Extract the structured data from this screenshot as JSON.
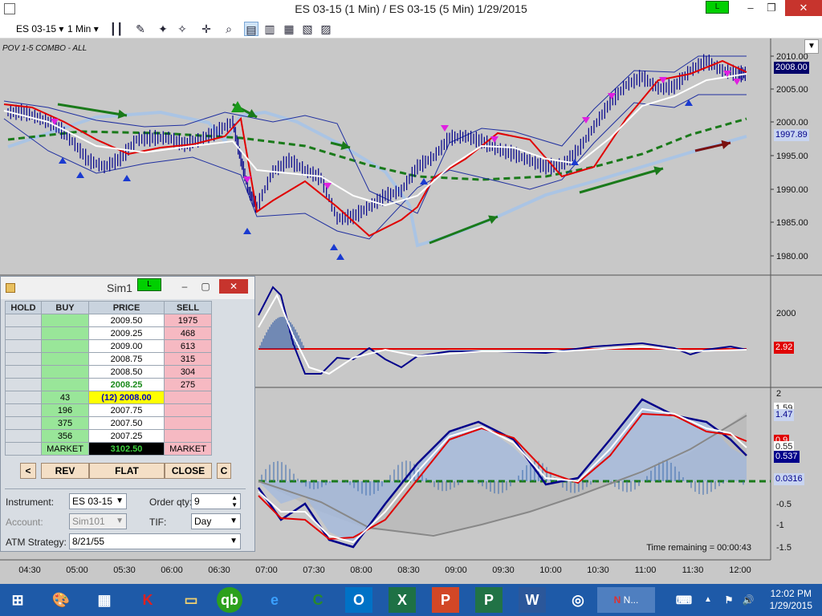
{
  "window": {
    "title": "ES 03-15 (1 Min) / ES 03-15 (5 Min)  1/29/2015",
    "status_badge": "L",
    "minimize": "–",
    "maximize": "❐",
    "close": "✕"
  },
  "toolbar": {
    "instrument": "ES 03-15",
    "interval": "1 Min"
  },
  "chart": {
    "name": "POV 1-5 COMBO - ALL",
    "price_axis": [
      "2010.00",
      "2005.00",
      "2000.00",
      "1995.00",
      "1990.00",
      "1985.00",
      "1980.00"
    ],
    "last_price": "2008.00",
    "other_price": "1997.89",
    "panel2_axis": [
      "2000"
    ],
    "panel2_value": "2.92",
    "panel3_axis": [
      "2",
      "-0.5",
      "-1",
      "-1.5"
    ],
    "panel3_values": [
      "1.59",
      "1.47",
      "0.9",
      "0.55",
      "0.537",
      "0.0316"
    ],
    "time_remaining": "Time remaining = 00:00:43",
    "time_axis": [
      "04:30",
      "05:00",
      "05:30",
      "06:00",
      "06:30",
      "07:00",
      "07:30",
      "08:00",
      "08:30",
      "09:00",
      "09:30",
      "10:00",
      "10:30",
      "11:00",
      "11:30",
      "12:00"
    ],
    "colors": {
      "background": "#c8c8c8",
      "price_bars": "#00008b",
      "red_line": "#e00000",
      "white_line": "#ffffff",
      "green_dashed": "#1a7a1a",
      "light_blue": "#aac4e4"
    }
  },
  "dom": {
    "title": "Sim1",
    "badge": "L",
    "headers": [
      "HOLD",
      "BUY",
      "PRICE",
      "SELL"
    ],
    "rows": [
      {
        "hold": "",
        "buy": "",
        "price": "2009.50",
        "sell": "1975"
      },
      {
        "hold": "",
        "buy": "",
        "price": "2009.25",
        "sell": "468"
      },
      {
        "hold": "",
        "buy": "",
        "price": "2009.00",
        "sell": "613"
      },
      {
        "hold": "",
        "buy": "",
        "price": "2008.75",
        "sell": "315"
      },
      {
        "hold": "",
        "buy": "",
        "price": "2008.50",
        "sell": "304"
      },
      {
        "hold": "",
        "buy": "",
        "price": "2008.25",
        "sell": "275"
      },
      {
        "hold": "",
        "buy": "43",
        "price": "(12) 2008.00",
        "sell": ""
      },
      {
        "hold": "",
        "buy": "196",
        "price": "2007.75",
        "sell": ""
      },
      {
        "hold": "",
        "buy": "375",
        "price": "2007.50",
        "sell": ""
      },
      {
        "hold": "",
        "buy": "356",
        "price": "2007.25",
        "sell": ""
      }
    ],
    "market_buy": "MARKET",
    "market_value": "3102.50",
    "market_sell": "MARKET",
    "buttons": {
      "left": "<",
      "rev": "REV",
      "flat": "FLAT",
      "close": "CLOSE",
      "c": "C"
    },
    "instrument_label": "Instrument:",
    "instrument_value": "ES 03-15",
    "order_qty_label": "Order qty:",
    "order_qty_value": "9",
    "account_label": "Account:",
    "account_value": "Sim101",
    "tif_label": "TIF:",
    "tif_value": "Day",
    "atm_label": "ATM Strategy:",
    "atm_value": "8/21/55"
  },
  "taskbar": {
    "active_app": "N...",
    "time": "12:02 PM",
    "date": "1/29/2015"
  }
}
